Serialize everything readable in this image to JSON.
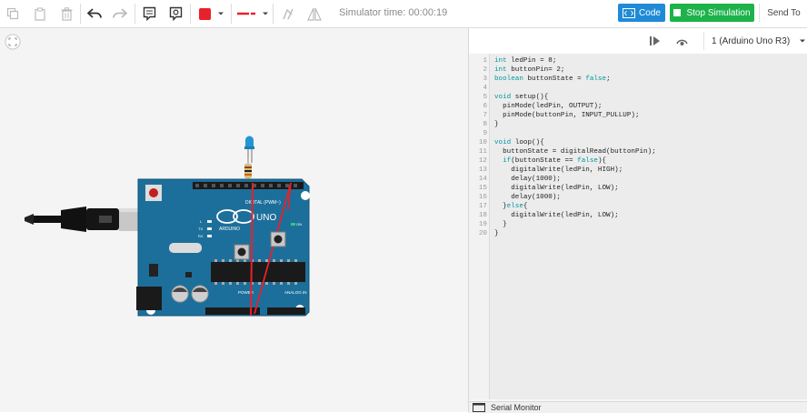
{
  "toolbar": {
    "sim_time_label": "Simulator time: 00:00:19",
    "code_label": "Code",
    "stop_label": "Stop Simulation",
    "send_label": "Send To",
    "color_swatch": "#e8212b",
    "wire_color": "#e8212b"
  },
  "board_select": {
    "value": "1 (Arduino Uno R3)"
  },
  "code_lines": [
    "int ledPin = 8;",
    "int buttonPin= 2;",
    "boolean buttonState = false;",
    "",
    "void setup(){",
    "  pinMode(ledPin, OUTPUT);",
    "  pinMode(buttonPin, INPUT_PULLUP);",
    "}",
    "",
    "void loop(){",
    "  buttonState = digitalRead(buttonPin);",
    "  if(buttonState == false){",
    "    digitalWrite(ledPin, HIGH);",
    "    delay(1000);",
    "    digitalWrite(ledPin, LOW);",
    "    delay(1000);",
    "  }else{",
    "    digitalWrite(ledPin, LOW);",
    "  }",
    "}"
  ],
  "serial_monitor_label": "Serial Monitor",
  "board_labels": {
    "brand": "UNO",
    "digital": "DIGITAL (PWM~)",
    "analog": "ANALOG IN",
    "power": "POWER",
    "arduino": "ARDUINO",
    "on": "ON",
    "l": "L",
    "tx": "TX",
    "rx": "RX"
  }
}
